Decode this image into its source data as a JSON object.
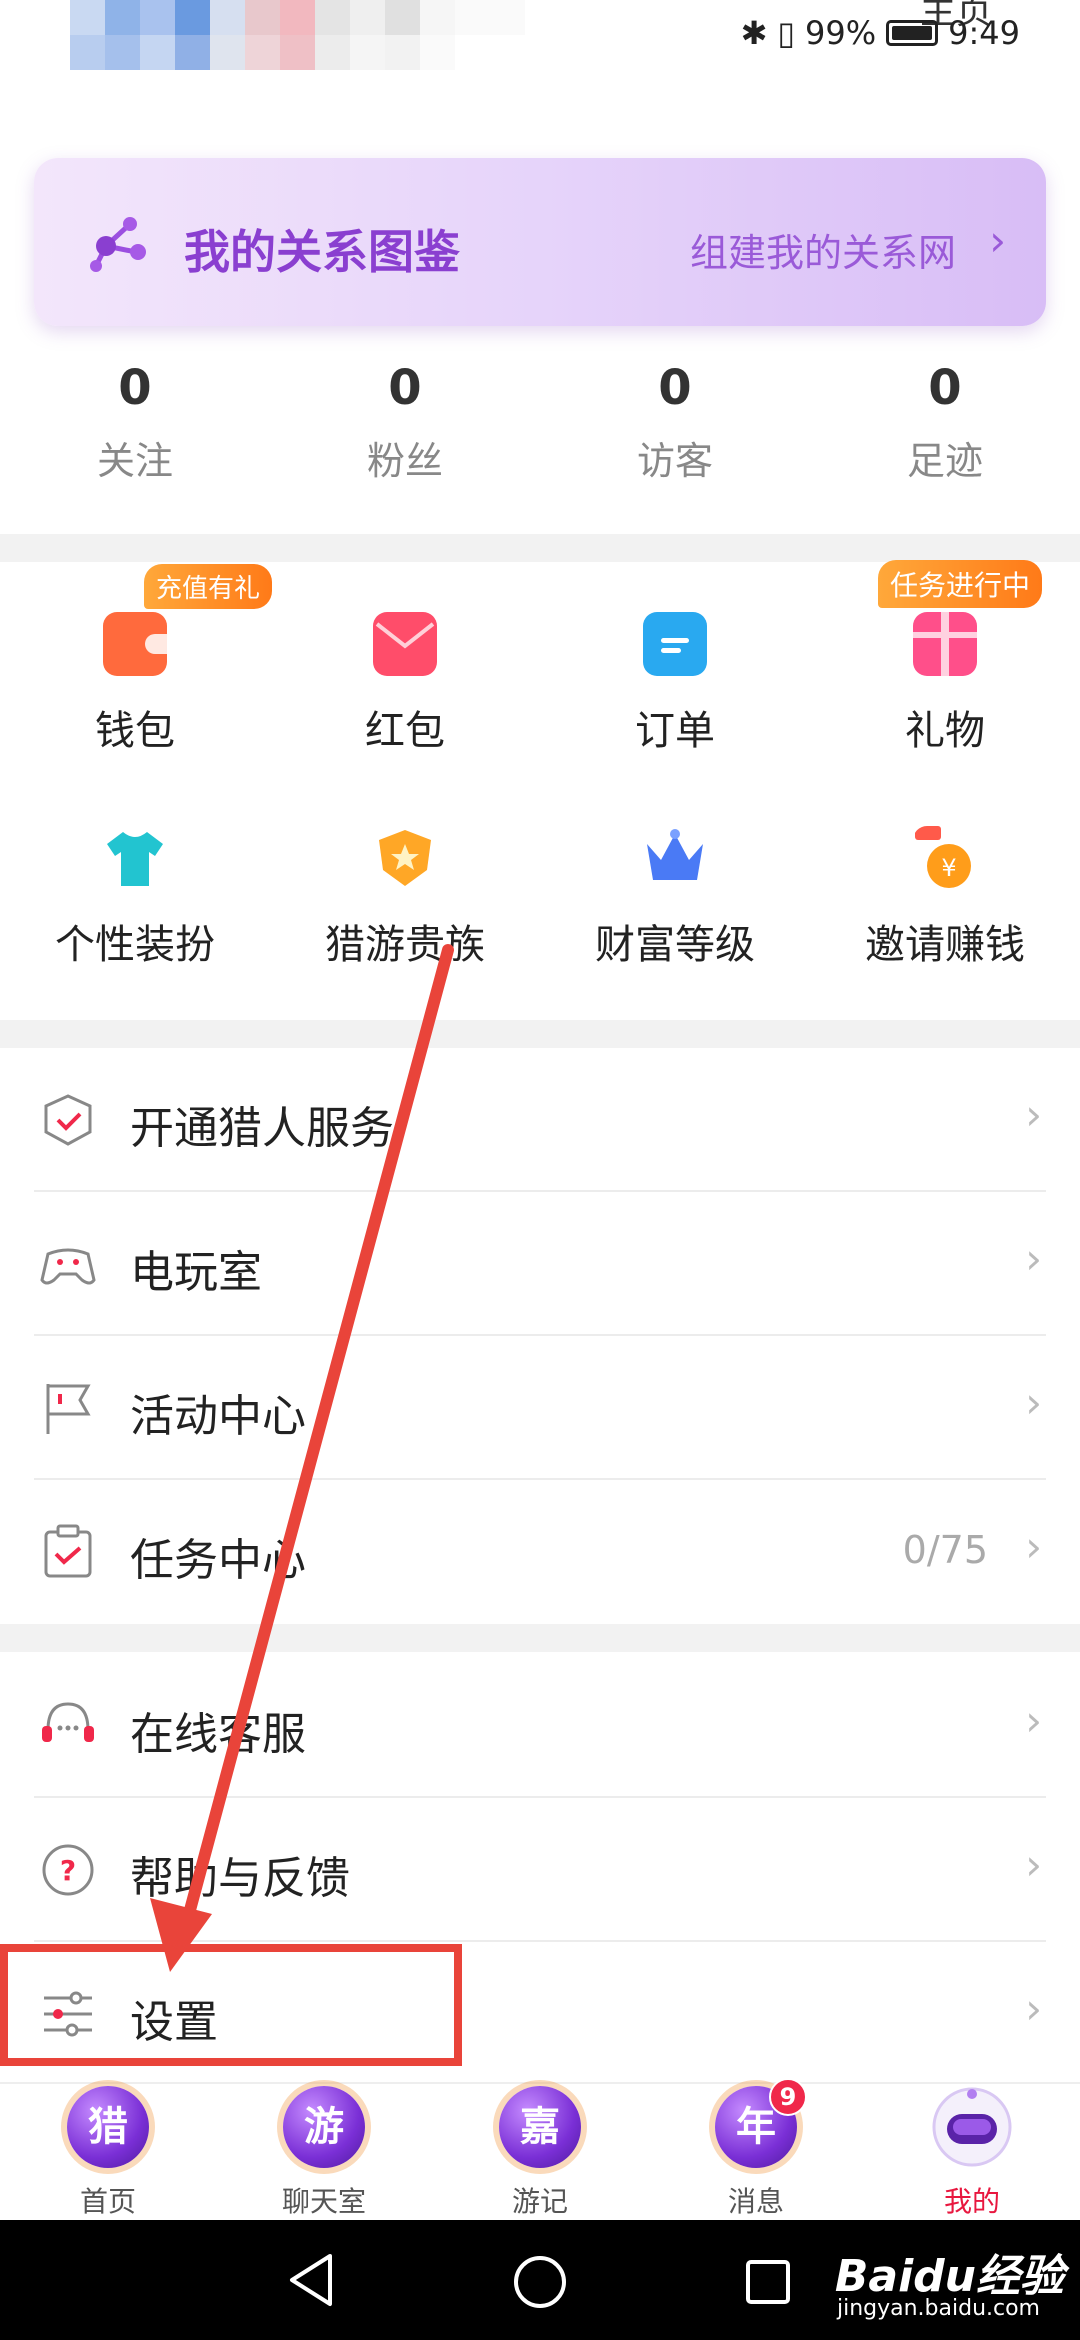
{
  "status": {
    "battery": "99%",
    "time": "9:49",
    "top_right_label": "主页"
  },
  "banner": {
    "title": "我的关系图鉴",
    "link": "组建我的关系网"
  },
  "stats": [
    {
      "value": "0",
      "label": "关注"
    },
    {
      "value": "0",
      "label": "粉丝"
    },
    {
      "value": "0",
      "label": "访客"
    },
    {
      "value": "0",
      "label": "足迹"
    }
  ],
  "grid": [
    {
      "label": "钱包",
      "badge": "充值有礼",
      "icon": "wallet-icon",
      "color": "#ff6a3d"
    },
    {
      "label": "红包",
      "badge": "",
      "icon": "red-envelope-icon",
      "color": "#ff4d6a"
    },
    {
      "label": "订单",
      "badge": "",
      "icon": "order-icon",
      "color": "#29a9f0"
    },
    {
      "label": "礼物",
      "badge": "任务进行中",
      "icon": "gift-icon",
      "color": "#ff4f8a"
    },
    {
      "label": "个性装扮",
      "badge": "",
      "icon": "tshirt-icon",
      "color": "#22c4d0"
    },
    {
      "label": "猎游贵族",
      "badge": "",
      "icon": "noble-badge-icon",
      "color": "#ffa726"
    },
    {
      "label": "财富等级",
      "badge": "",
      "icon": "crown-icon",
      "color": "#4a7af5"
    },
    {
      "label": "邀请赚钱",
      "badge": "",
      "icon": "money-bag-icon",
      "color": "#ff9d1a"
    }
  ],
  "list1": [
    {
      "label": "开通猎人服务",
      "value": "",
      "icon": "shield-check-icon"
    },
    {
      "label": "电玩室",
      "value": "",
      "icon": "gamepad-icon"
    },
    {
      "label": "活动中心",
      "value": "",
      "icon": "flag-icon"
    },
    {
      "label": "任务中心",
      "value": "0/75",
      "icon": "clipboard-check-icon"
    }
  ],
  "list2": [
    {
      "label": "在线客服",
      "value": "",
      "icon": "headset-icon"
    },
    {
      "label": "帮助与反馈",
      "value": "",
      "icon": "question-icon"
    },
    {
      "label": "设置",
      "value": "",
      "icon": "sliders-icon"
    }
  ],
  "tabs": [
    {
      "label": "首页",
      "glyph": "猎"
    },
    {
      "label": "聊天室",
      "glyph": "游"
    },
    {
      "label": "游记",
      "glyph": "嘉"
    },
    {
      "label": "消息",
      "glyph": "年",
      "badge": "9"
    },
    {
      "label": "我的",
      "glyph": ""
    }
  ],
  "watermark": {
    "brand": "Baidu经验",
    "url": "jingyan.baidu.com"
  },
  "colors": {
    "accent": "#8a3fd0",
    "active_tab": "#e8173f",
    "annotation": "#e9443a"
  }
}
